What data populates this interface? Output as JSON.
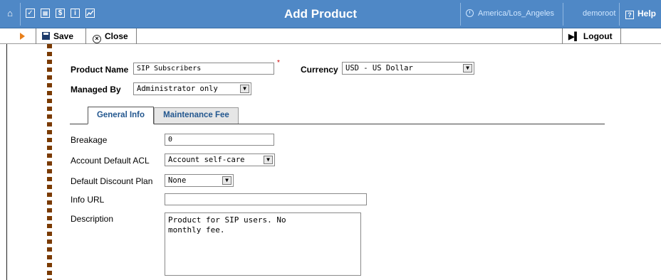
{
  "window": {
    "title": "Add Product",
    "timezone": "America/Los_Angeles",
    "user": "demoroot",
    "help_label": "Help"
  },
  "topnav_icons": [
    "home-icon",
    "checkmark-icon",
    "tree-icon",
    "dollar-icon",
    "info-icon",
    "chart-icon"
  ],
  "toolbar": {
    "save_label": "Save",
    "close_label": "Close",
    "logout_label": "Logout"
  },
  "form": {
    "product_name_label": "Product Name",
    "product_name_value": "SIP Subscribers",
    "required_mark": "*",
    "currency_label": "Currency",
    "currency_value": "USD - US Dollar",
    "managed_by_label": "Managed By",
    "managed_by_value": "Administrator only"
  },
  "tabs": [
    {
      "label": "General Info",
      "active": true
    },
    {
      "label": "Maintenance Fee",
      "active": false
    }
  ],
  "general_info": {
    "breakage_label": "Breakage",
    "breakage_value": "0",
    "acl_label": "Account Default ACL",
    "acl_value": "Account self-care",
    "discount_label": "Default Discount Plan",
    "discount_value": "None",
    "info_url_label": "Info URL",
    "info_url_value": "",
    "description_label": "Description",
    "description_value": "Product for SIP users. No\nmonthly fee."
  },
  "colors": {
    "title_bar": "#4f88c6",
    "rail": "#7a3a00",
    "tab_text": "#23578f",
    "required": "#cc0000"
  }
}
